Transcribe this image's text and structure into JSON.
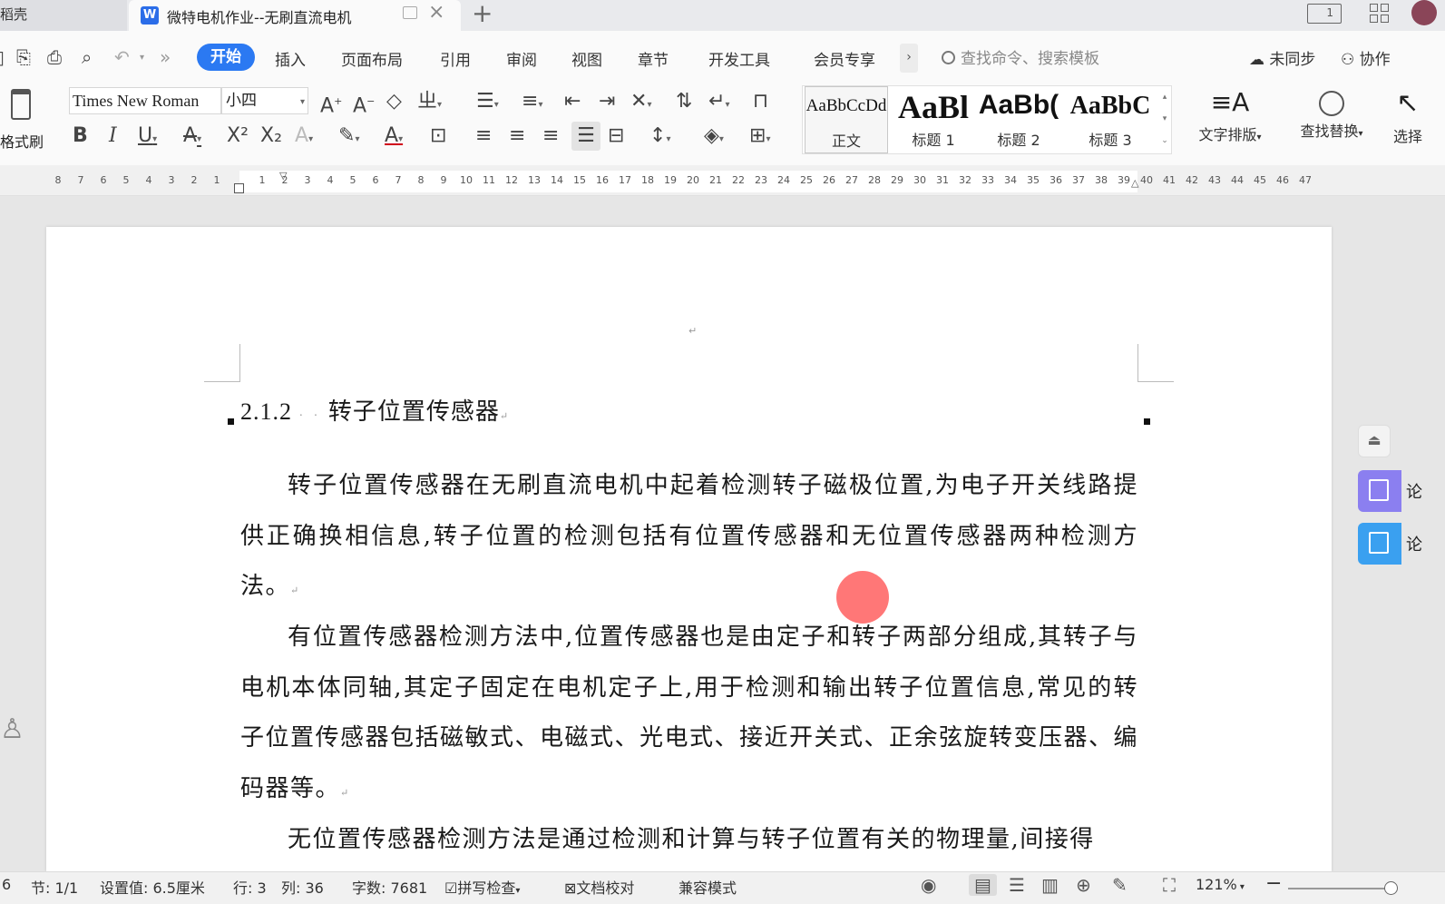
{
  "tabs": {
    "left_partial": "稻壳",
    "active_title": "微特电机作业--无刷直流电机",
    "app_badge": "W"
  },
  "menu": {
    "items": [
      "开始",
      "插入",
      "页面布局",
      "引用",
      "审阅",
      "视图",
      "章节",
      "开发工具",
      "会员专享"
    ],
    "search_placeholder": "查找命令、搜索模板",
    "sync_label": "未同步",
    "collab_label": "协作",
    "accent": "#2b79f2"
  },
  "ribbon": {
    "format_brush_label": "格式刷",
    "font_name": "Times New Roman",
    "font_size": "小四",
    "styles": [
      {
        "preview": "AaBbCcDd",
        "name": "正文"
      },
      {
        "preview": "AaBl",
        "name": "标题 1"
      },
      {
        "preview": "AaBb(",
        "name": "标题 2"
      },
      {
        "preview": "AaBbC",
        "name": "标题 3"
      }
    ],
    "text_layout_label": "文字排版",
    "find_replace_label": "查找替换",
    "select_label": "选择"
  },
  "ruler": {
    "left_numbers": [
      "8",
      "7",
      "6",
      "5",
      "4",
      "3",
      "2",
      "1"
    ],
    "right_numbers": [
      "1",
      "2",
      "3",
      "4",
      "5",
      "6",
      "7",
      "8",
      "9",
      "10",
      "11",
      "12",
      "13",
      "14",
      "15",
      "16",
      "17",
      "18",
      "19",
      "20",
      "21",
      "22",
      "23",
      "24",
      "25",
      "26",
      "27",
      "28",
      "29",
      "30",
      "31",
      "32",
      "33",
      "34",
      "35",
      "36",
      "37",
      "38",
      "39",
      "40",
      "41",
      "42",
      "43",
      "44",
      "45",
      "46",
      "47"
    ]
  },
  "document": {
    "heading_number": "2.1.2",
    "heading_title": "转子位置传感器",
    "paragraphs": [
      "转子位置传感器在无刷直流电机中起着检测转子磁极位置,为电子开关线路提供正确换相信息,转子位置的检测包括有位置传感器和无位置传感器两种检测方法。",
      "有位置传感器检测方法中,位置传感器也是由定子和转子两部分组成,其转子与电机本体同轴,其定子固定在电机定子上,用于检测和输出转子位置信息,常见的转子位置传感器包括磁敏式、电磁式、光电式、接近开关式、正余弦旋转变压器、编码器等。",
      "无位置传感器检测方法是通过检测和计算与转子位置有关的物理量,间接得"
    ]
  },
  "side_panel": {
    "btn1_label": "论",
    "btn2_label": "论",
    "btn1_color": "#8b7ff0",
    "btn2_color": "#3aa0f0"
  },
  "status": {
    "page": "6",
    "section": "节: 1/1",
    "setting": "设置值: 6.5厘米",
    "row": "行: 3",
    "col": "列: 36",
    "word_count": "字数: 7681",
    "spell_check": "拼写检查",
    "doc_proof": "文档校对",
    "compat": "兼容模式",
    "zoom": "121%"
  }
}
